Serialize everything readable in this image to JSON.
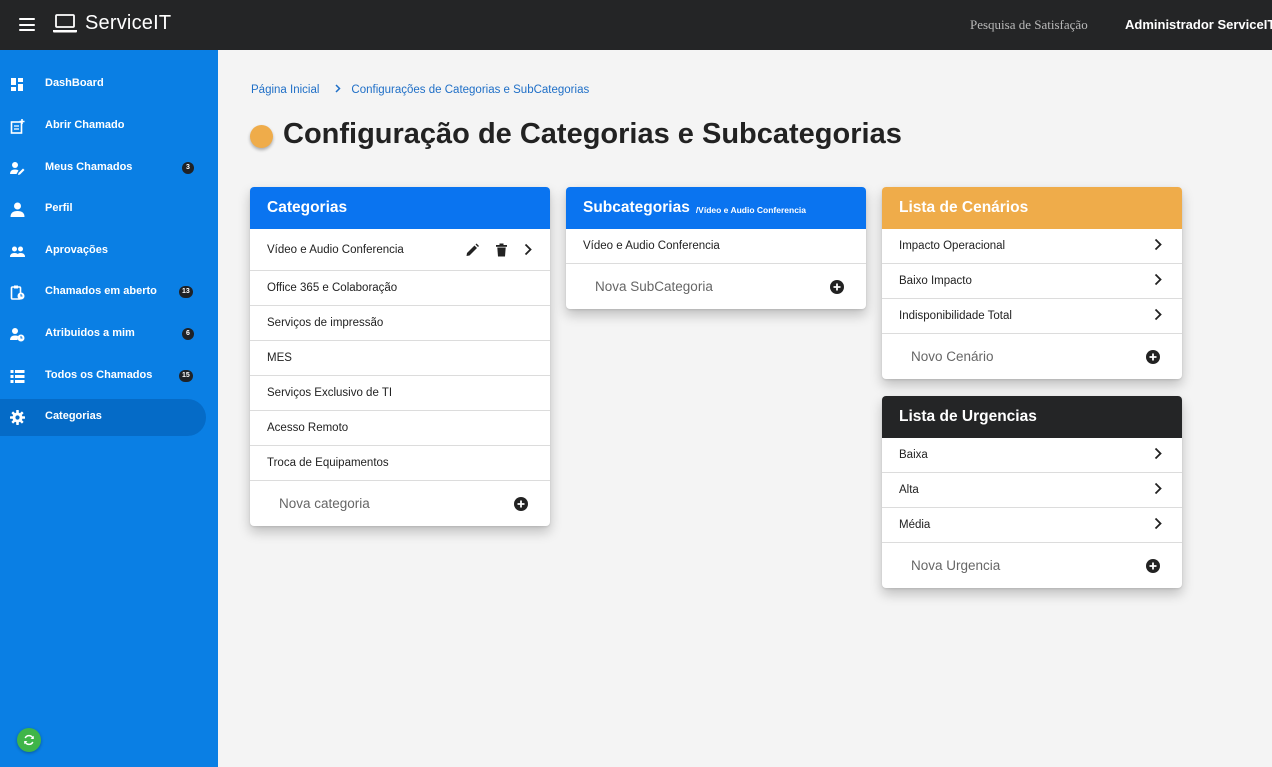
{
  "app": {
    "name": "ServiceIT",
    "top_link": "Pesquisa de Satisfação",
    "user_name": "Administrador ServiceIT"
  },
  "sidebar": {
    "items": [
      {
        "label": "DashBoard",
        "icon": "dashboard-icon"
      },
      {
        "label": "Abrir Chamado",
        "icon": "note-add-icon"
      },
      {
        "label": "Meus Chamados",
        "icon": "person-edit-icon",
        "badge": "3"
      },
      {
        "label": "Perfil",
        "icon": "person-icon"
      },
      {
        "label": "Aprovações",
        "icon": "group-icon"
      },
      {
        "label": "Chamados em aberto",
        "icon": "clipboard-clock-icon",
        "badge": "13"
      },
      {
        "label": "Atribuidos a mim",
        "icon": "person-clock-icon",
        "badge": "6"
      },
      {
        "label": "Todos os Chamados",
        "icon": "list-icon",
        "badge": "15"
      },
      {
        "label": "Categorias",
        "icon": "gear-icon",
        "active": true
      }
    ]
  },
  "breadcrumb": {
    "home": "Página Inicial",
    "current": "Configurações de Categorias e SubCategorias"
  },
  "page": {
    "title": "Configuração de Categorias e Subcategorias"
  },
  "categorias": {
    "title": "Categorias",
    "items": [
      "Vídeo e Audio Conferencia",
      "Office 365 e Colaboração",
      "Serviços de impressão",
      "MES",
      "Serviços Exclusivo de TI",
      "Acesso Remoto",
      "Troca de Equipamentos"
    ],
    "add_label": "Nova categoria"
  },
  "subcategorias": {
    "title": "Subcategorias",
    "subtitle": "/Vídeo e Audio Conferencia",
    "items": [
      "Vídeo e Audio Conferencia"
    ],
    "add_label": "Nova SubCategoria"
  },
  "cenarios": {
    "title": "Lista de Cenários",
    "items": [
      "Impacto Operacional",
      "Baixo Impacto",
      "Indisponibilidade Total"
    ],
    "add_label": "Novo Cenário"
  },
  "urgencias": {
    "title": "Lista de Urgencias",
    "items": [
      "Baixa",
      "Alta",
      "Média"
    ],
    "add_label": "Nova Urgencia"
  },
  "colors": {
    "topbar": "#242526",
    "sidebar": "#0a7fe4",
    "sidebar_active": "#056bc7",
    "header_blue": "#0a74f0",
    "header_orange": "#efac4a",
    "header_dark": "#242526",
    "refresh_green": "#3fb549"
  }
}
